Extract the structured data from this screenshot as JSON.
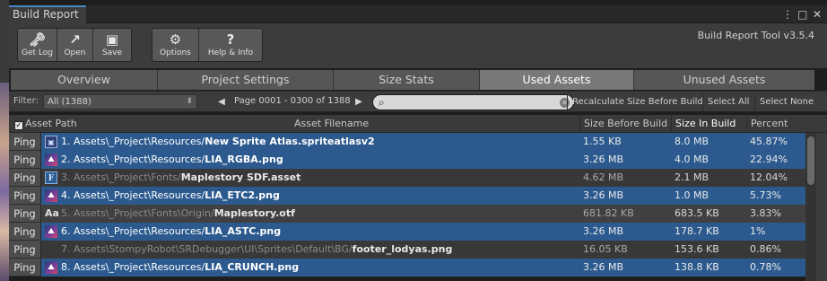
{
  "window": {
    "tab_title": "Build Report",
    "controls": [
      "⋮",
      "□",
      "✕"
    ]
  },
  "toolbar": {
    "buttons": [
      {
        "label": "Get Log",
        "icon": "🗝",
        "icon_name": "get-log-icon"
      },
      {
        "label": "Open",
        "icon": "↗",
        "icon_name": "open-folder-icon"
      },
      {
        "label": "Save",
        "icon": "▣",
        "icon_name": "save-disk-icon"
      },
      {
        "label": "Options",
        "icon": "⚙",
        "icon_name": "gear-icon"
      },
      {
        "label": "Help & Info",
        "icon": "?",
        "icon_name": "help-icon"
      }
    ],
    "version": "Build Report Tool v3.5.4"
  },
  "tabs": [
    "Overview",
    "Project Settings",
    "Size Stats",
    "Used Assets",
    "Unused Assets"
  ],
  "active_tab": "Used Assets",
  "filter": {
    "label": "Filter:",
    "value": "All (1388)",
    "page_label": "Page 0001 - 0300 of 1388",
    "search_placeholder": "",
    "recalc_label": "Recalculate Size Before Build",
    "select_all_label": "Select All",
    "select_none_label": "Select None"
  },
  "columns": {
    "asset_path": "Asset Path",
    "asset_filename": "Asset Filename",
    "size_before": "Size Before Build",
    "size_in_build": "Size In Build ▼",
    "percent": "Percent"
  },
  "colors": {
    "selection": "#2c5a8f",
    "active_tab": "#797979",
    "tab_accent": "#4a86c8"
  },
  "rows": [
    {
      "ping": "Ping",
      "icon": "sprite-atlas-icon",
      "glyph": "▣",
      "num": "1. ",
      "dir": "Assets\\_Project\\Resources/",
      "file": "New Sprite Atlas.spriteatlasv2",
      "before": "1.55 KB",
      "build": "8.0 MB",
      "pct": "45.87%",
      "selected": true
    },
    {
      "ping": "Ping",
      "icon": "image-icon",
      "glyph": "⛰",
      "num": "2. ",
      "dir": "Assets\\_Project\\Resources/",
      "file": "LIA_RGBA.png",
      "before": "3.26 MB",
      "build": "4.0 MB",
      "pct": "22.94%",
      "selected": true
    },
    {
      "ping": "Ping",
      "icon": "font-asset-icon",
      "glyph": "F",
      "num": "3. ",
      "dir": "Assets\\_Project\\Fonts/",
      "file": "Maplestory SDF.asset",
      "before": "4.62 MB",
      "build": "2.1 MB",
      "pct": "12.04%",
      "selected": false
    },
    {
      "ping": "Ping",
      "icon": "image-icon",
      "glyph": "⛰",
      "num": "4. ",
      "dir": "Assets\\_Project\\Resources/",
      "file": "LIA_ETC2.png",
      "before": "3.26 MB",
      "build": "1.0 MB",
      "pct": "5.73%",
      "selected": true
    },
    {
      "ping": "Ping",
      "icon": "font-file-icon",
      "glyph": "Aa",
      "num": "5. ",
      "dir": "Assets\\_Project\\Fonts\\Origin/",
      "file": "Maplestory.otf",
      "before": "681.82 KB",
      "build": "683.5 KB",
      "pct": "3.83%",
      "selected": false
    },
    {
      "ping": "Ping",
      "icon": "image-icon",
      "glyph": "⛰",
      "num": "6. ",
      "dir": "Assets\\_Project\\Resources/",
      "file": "LIA_ASTC.png",
      "before": "3.26 MB",
      "build": "178.7 KB",
      "pct": "1%",
      "selected": true
    },
    {
      "ping": "Ping",
      "icon": "",
      "glyph": "",
      "num": "7. ",
      "dir": "Assets\\StompyRobot\\SRDebugger\\UI\\Sprites\\Default\\BG/",
      "file": "footer_lodyas.png",
      "before": "16.05 KB",
      "build": "153.6 KB",
      "pct": "0.86%",
      "selected": false
    },
    {
      "ping": "Ping",
      "icon": "image-icon",
      "glyph": "⛰",
      "num": "8. ",
      "dir": "Assets\\_Project\\Resources/",
      "file": "LIA_CRUNCH.png",
      "before": "3.26 MB",
      "build": "138.8 KB",
      "pct": "0.78%",
      "selected": true
    }
  ]
}
